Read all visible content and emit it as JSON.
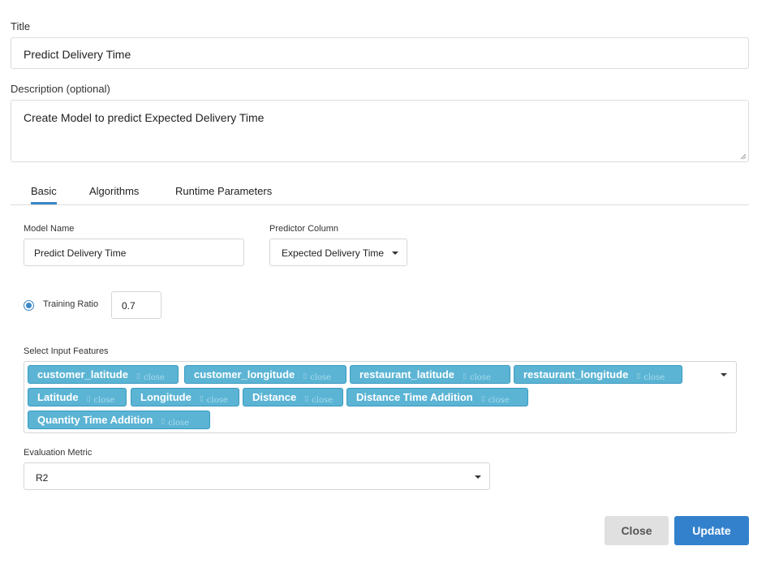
{
  "form": {
    "title_label": "Title",
    "title_value": "Predict Delivery Time",
    "description_label": "Description (optional)",
    "description_value": "Create Model to predict Expected Delivery Time"
  },
  "tabs": [
    {
      "label": "Basic",
      "active": true
    },
    {
      "label": "Algorithms",
      "active": false
    },
    {
      "label": "Runtime Parameters",
      "active": false
    }
  ],
  "basic": {
    "model_name_label": "Model Name",
    "model_name_value": "Predict Delivery Time",
    "predictor_label": "Predictor Column",
    "predictor_value": "Expected Delivery Time",
    "training_ratio_label": "Training Ratio",
    "training_ratio_value": "0.7",
    "features_label": "Select Input Features",
    "features": [
      "customer_latitude",
      "customer_longitude",
      "restaurant_latitude",
      "restaurant_longitude",
      "Latitude",
      "Longitude",
      "Distance",
      "Distance Time Addition",
      "Quantity Time Addition"
    ],
    "chip_separator": "▯",
    "chip_close_text": "close",
    "metric_label": "Evaluation Metric",
    "metric_value": "R2"
  },
  "footer": {
    "close_label": "Close",
    "update_label": "Update"
  },
  "colors": {
    "accent": "#3b87c7",
    "chip": "#5bb4d4",
    "update_button": "#3381cc",
    "close_button": "#e0e0e0"
  }
}
